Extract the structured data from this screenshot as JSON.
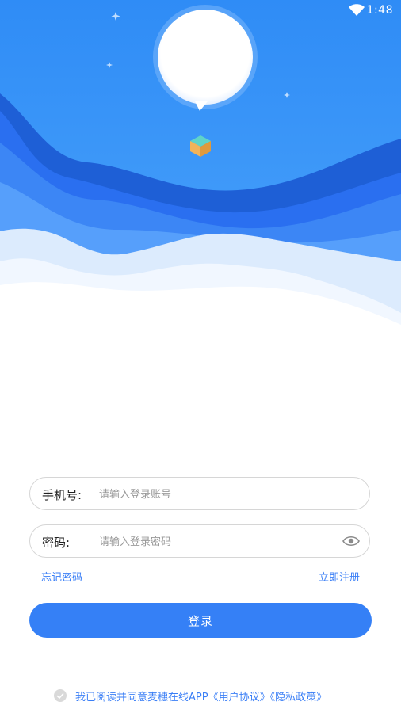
{
  "status": {
    "time": "1:48"
  },
  "form": {
    "phone_label": "手机号:",
    "phone_placeholder": "请输入登录账号",
    "password_label": "密码:",
    "password_placeholder": "请输入登录密码"
  },
  "links": {
    "forgot": "忘记密码",
    "register": "立即注册"
  },
  "login_button": "登录",
  "agreement": {
    "text": "我已阅读并同意麦穗在线APP",
    "user_agreement": "《用户协议》",
    "privacy_policy": "《隐私政策》"
  },
  "colors": {
    "primary": "#3580f6",
    "link": "#3b7ff6"
  }
}
